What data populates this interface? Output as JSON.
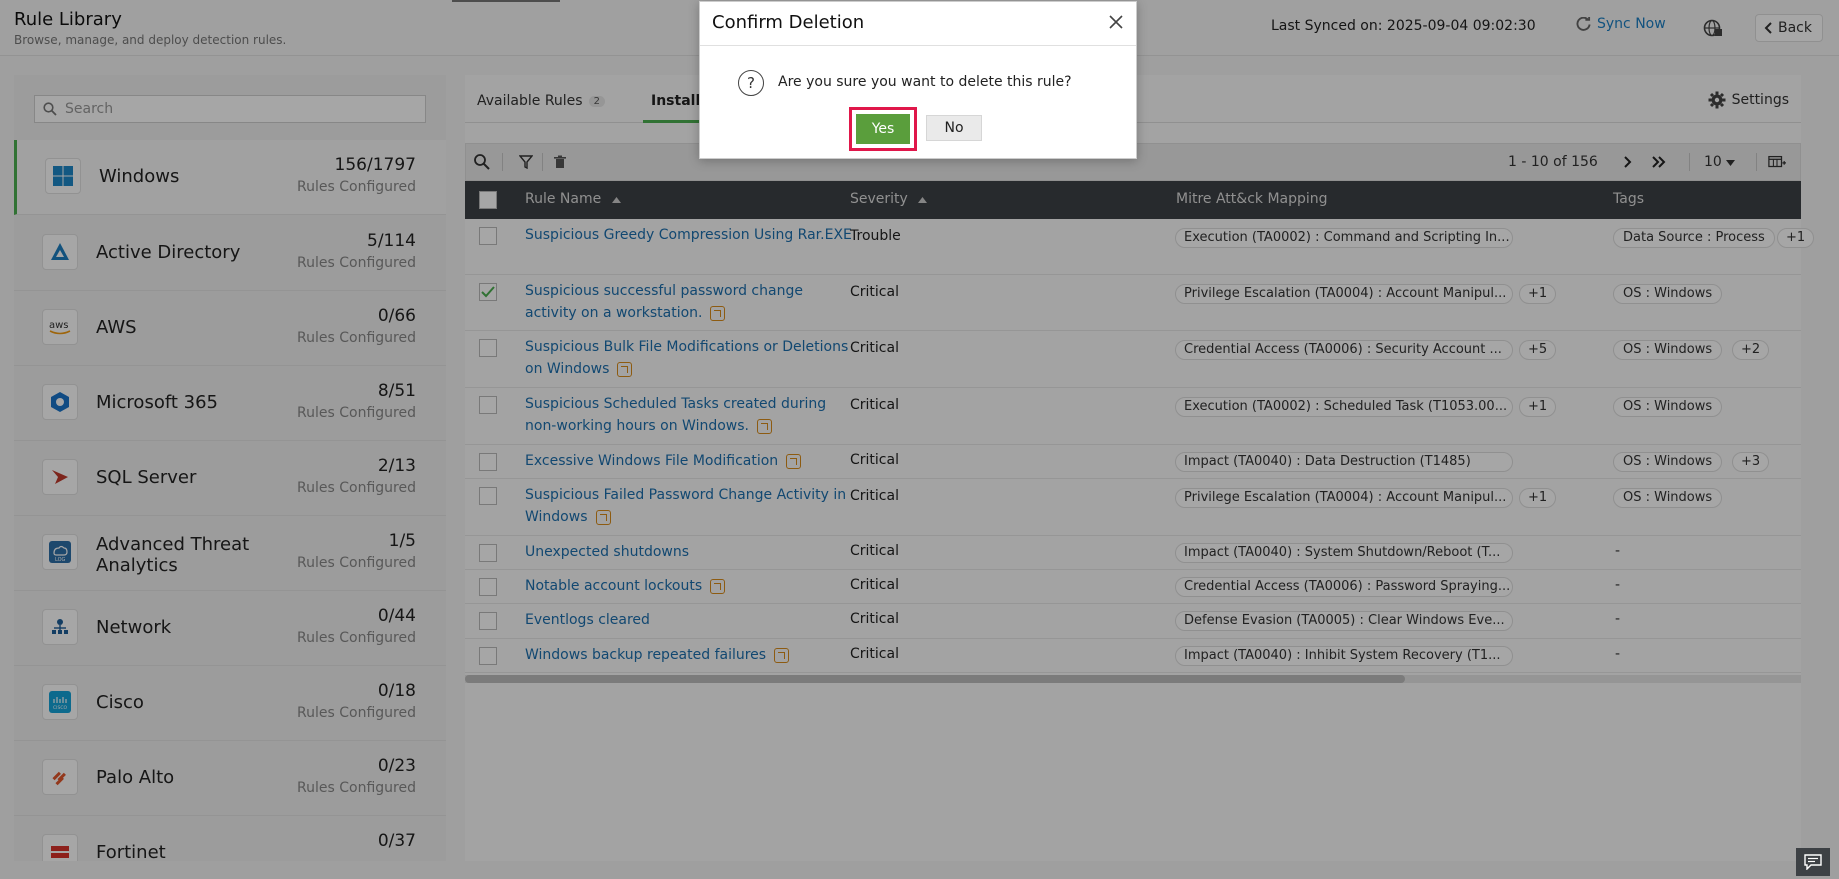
{
  "header": {
    "title": "Rule Library",
    "subtitle": "Browse, manage, and deploy detection rules.",
    "last_synced": "Last Synced on: 2025-09-04 09:02:30",
    "sync_now": "Sync Now",
    "back": "Back"
  },
  "sidebar": {
    "search_placeholder": "Search",
    "items": [
      {
        "name": "Windows",
        "count": "156/1797",
        "sub": "Rules Configured",
        "icon": "windows-icon"
      },
      {
        "name": "Active Directory",
        "count": "5/114",
        "sub": "Rules Configured",
        "icon": "active-directory-icon"
      },
      {
        "name": "AWS",
        "count": "0/66",
        "sub": "Rules Configured",
        "icon": "aws-icon"
      },
      {
        "name": "Microsoft 365",
        "count": "8/51",
        "sub": "Rules Configured",
        "icon": "microsoft-365-icon"
      },
      {
        "name": "SQL Server",
        "count": "2/13",
        "sub": "Rules Configured",
        "icon": "sql-server-icon"
      },
      {
        "name": "Advanced Threat Analytics",
        "count": "1/5",
        "sub": "Rules Configured",
        "icon": "ata-icon"
      },
      {
        "name": "Network",
        "count": "0/44",
        "sub": "Rules Configured",
        "icon": "network-icon"
      },
      {
        "name": "Cisco",
        "count": "0/18",
        "sub": "Rules Configured",
        "icon": "cisco-icon"
      },
      {
        "name": "Palo Alto",
        "count": "0/23",
        "sub": "Rules Configured",
        "icon": "palo-alto-icon"
      },
      {
        "name": "Fortinet",
        "count": "0/37",
        "sub": "",
        "icon": "fortinet-icon"
      }
    ]
  },
  "tabs": {
    "available": "Available Rules",
    "available_badge": "2",
    "installed": "Install",
    "settings": "Settings"
  },
  "toolbar": {
    "page_info": "1 - 10 of 156",
    "per_page": "10"
  },
  "table": {
    "headers": {
      "rule_name": "Rule Name",
      "severity": "Severity",
      "mitre": "Mitre Att&ck Mapping",
      "tags": "Tags"
    },
    "rows": [
      {
        "name": "Suspicious Greedy Compression Using Rar.EXE",
        "severity": "Trouble",
        "mitre": "Execution (TA0002) : Command and Scripting In...",
        "mitre_more": "",
        "tag": "Data Source : Process",
        "tag_more": "+1",
        "checked": false,
        "has_icon": false
      },
      {
        "name": "Suspicious successful password change activity on a workstation.",
        "severity": "Critical",
        "mitre": "Privilege Escalation (TA0004) : Account Manipul...",
        "mitre_more": "+1",
        "tag": "OS : Windows",
        "tag_more": "",
        "checked": true,
        "has_icon": true
      },
      {
        "name": "Suspicious Bulk File Modifications or Deletions on Windows",
        "severity": "Critical",
        "mitre": "Credential Access (TA0006) : Security Account ...",
        "mitre_more": "+5",
        "tag": "OS : Windows",
        "tag_more": "+2",
        "checked": false,
        "has_icon": true
      },
      {
        "name": "Suspicious Scheduled Tasks created during non-working hours on Windows.",
        "severity": "Critical",
        "mitre": "Execution (TA0002) : Scheduled Task (T1053.00...",
        "mitre_more": "+1",
        "tag": "OS : Windows",
        "tag_more": "",
        "checked": false,
        "has_icon": true
      },
      {
        "name": "Excessive Windows File Modification",
        "severity": "Critical",
        "mitre": "Impact (TA0040) : Data Destruction (T1485)",
        "mitre_more": "",
        "tag": "OS : Windows",
        "tag_more": "+3",
        "checked": false,
        "has_icon": true
      },
      {
        "name": "Suspicious Failed Password Change Activity in Windows",
        "severity": "Critical",
        "mitre": "Privilege Escalation (TA0004) : Account Manipul...",
        "mitre_more": "+1",
        "tag": "OS : Windows",
        "tag_more": "",
        "checked": false,
        "has_icon": true
      },
      {
        "name": "Unexpected shutdowns",
        "severity": "Critical",
        "mitre": "Impact (TA0040) : System Shutdown/Reboot (T...",
        "mitre_more": "",
        "tag": "-",
        "tag_more": "",
        "checked": false,
        "has_icon": false
      },
      {
        "name": "Notable account lockouts",
        "severity": "Critical",
        "mitre": "Credential Access (TA0006) : Password Spraying...",
        "mitre_more": "",
        "tag": "-",
        "tag_more": "",
        "checked": false,
        "has_icon": true
      },
      {
        "name": "Eventlogs cleared",
        "severity": "Critical",
        "mitre": "Defense Evasion (TA0005) : Clear Windows Eve...",
        "mitre_more": "",
        "tag": "-",
        "tag_more": "",
        "checked": false,
        "has_icon": false
      },
      {
        "name": "Windows backup repeated failures",
        "severity": "Critical",
        "mitre": "Impact (TA0040) : Inhibit System Recovery (T1...",
        "mitre_more": "",
        "tag": "-",
        "tag_more": "",
        "checked": false,
        "has_icon": true
      }
    ]
  },
  "modal": {
    "title": "Confirm Deletion",
    "message": "Are you sure you want to delete this rule?",
    "yes": "Yes",
    "no": "No",
    "question_glyph": "?"
  },
  "colors": {
    "accent_green": "#4caf50",
    "yes_button": "#5a9e3c",
    "highlight": "#e0174a",
    "link": "#1d6fae"
  }
}
